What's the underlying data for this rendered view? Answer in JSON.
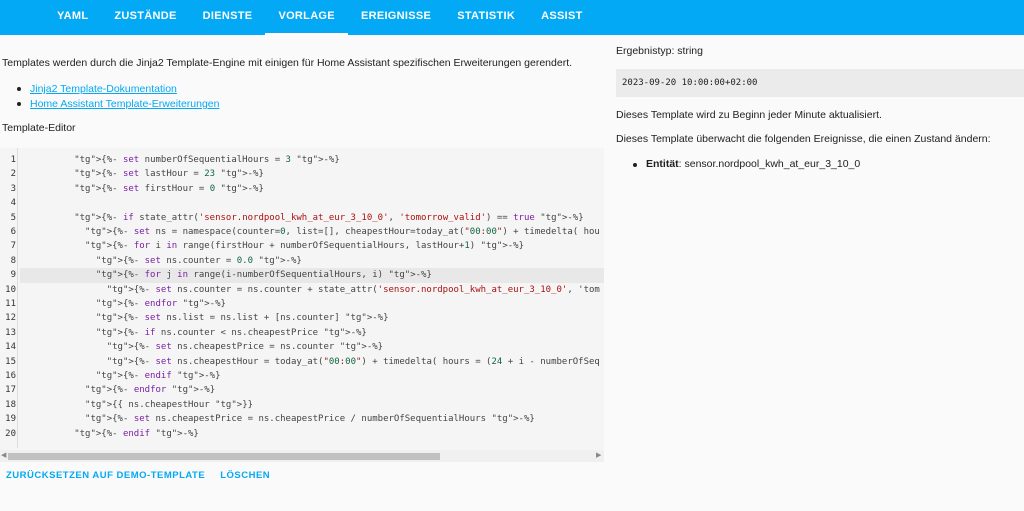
{
  "nav": {
    "tabs": [
      {
        "label": "YAML"
      },
      {
        "label": "ZUSTÄNDE"
      },
      {
        "label": "DIENSTE"
      },
      {
        "label": "VORLAGE"
      },
      {
        "label": "EREIGNISSE"
      },
      {
        "label": "STATISTIK"
      },
      {
        "label": "ASSIST"
      }
    ],
    "active_tab": "VORLAGE",
    "color": "#03a9f4"
  },
  "main": {
    "intro": "Templates werden durch die Jinja2 Template-Engine mit einigen für Home Assistant spezifischen Erweiterungen gerendert.",
    "links": [
      {
        "label": "Jinja2 Template-Dokumentation"
      },
      {
        "label": "Home Assistant Template-Erweiterungen"
      }
    ],
    "editor_label": "Template-Editor",
    "line_numbers": [
      "1",
      "2",
      "3",
      "4",
      "5",
      "6",
      "7",
      "8",
      "9",
      "10",
      "11",
      "12",
      "13",
      "14",
      "15",
      "16",
      "17",
      "18",
      "19",
      "20"
    ],
    "code_lines": [
      "          {%- set numberOfSequentialHours = 3 -%}",
      "          {%- set lastHour = 23 -%}",
      "          {%- set firstHour = 0 -%}",
      "",
      "          {%- if state_attr('sensor.nordpool_kwh_at_eur_3_10_0', 'tomorrow_valid') == true -%}",
      "            {%- set ns = namespace(counter=0, list=[], cheapestHour=today_at(\"00:00\") + timedelta( hou",
      "            {%- for i in range(firstHour + numberOfSequentialHours, lastHour+1) -%}",
      "              {%- set ns.counter = 0.0 -%}",
      "              {%- for j in range(i-numberOfSequentialHours, i) -%}",
      "                {%- set ns.counter = ns.counter + state_attr('sensor.nordpool_kwh_at_eur_3_10_0', 'tom",
      "              {%- endfor -%}",
      "              {%- set ns.list = ns.list + [ns.counter] -%}",
      "              {%- if ns.counter < ns.cheapestPrice -%}",
      "                {%- set ns.cheapestPrice = ns.counter -%}",
      "                {%- set ns.cheapestHour = today_at(\"00:00\") + timedelta( hours = (24 + i - numberOfSeq",
      "              {%- endif -%}",
      "            {%- endfor -%}",
      "            {{ ns.cheapestHour }}",
      "            {%- set ns.cheapestPrice = ns.cheapestPrice / numberOfSequentialHours -%}",
      "          {%- endif -%}"
    ],
    "reset_button": "ZURÜCKSETZEN AUF DEMO-TEMPLATE",
    "clear_button": "LÖSCHEN"
  },
  "result": {
    "type_label": "Ergebnistyp: string",
    "value": "2023-09-20 10:00:00+02:00",
    "update_info": "Dieses Template wird zu Beginn jeder Minute aktualisiert.",
    "listen_info": "Dieses Template überwacht die folgenden Ereignisse, die einen Zustand ändern:",
    "entity_label": "Entität",
    "entity_value": ": sensor.nordpool_kwh_at_eur_3_10_0"
  }
}
